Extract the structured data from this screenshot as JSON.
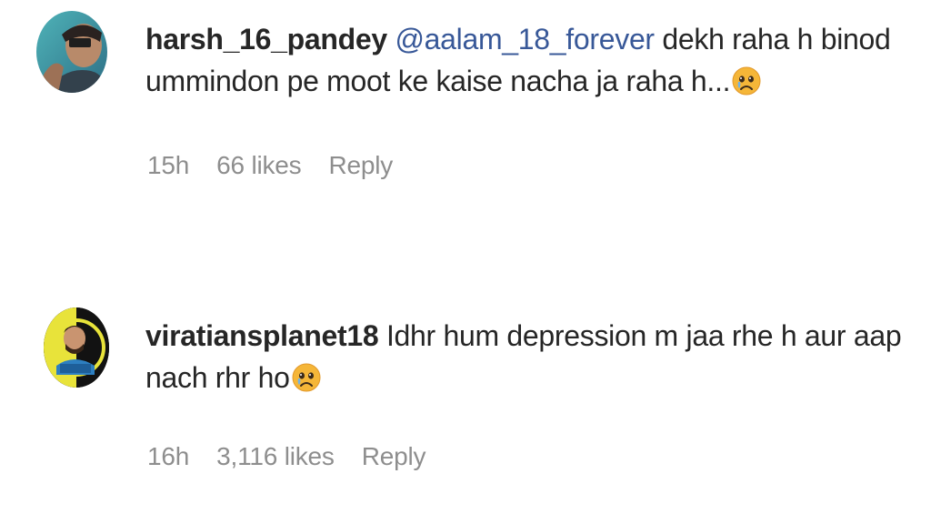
{
  "comments": [
    {
      "username": "harsh_16_pandey",
      "mention": "@aalam_18_forever",
      "text_line1": " dekh raha h binod",
      "text_line2": "ummindon pe moot ke kaise nacha ja raha h...",
      "emoji": "sad-emoji-icon",
      "time": "15h",
      "likes": "66 likes",
      "reply_label": "Reply"
    },
    {
      "username": "viratiansplanet18",
      "text_line1": " Idhr hum depression m jaa rhe h aur aap",
      "text_line2": "nach rhr ho",
      "emoji": "sad-emoji-icon",
      "time": "16h",
      "likes": "3,116 likes",
      "reply_label": "Reply"
    }
  ],
  "colors": {
    "text": "#262626",
    "mention": "#385898",
    "meta": "#8e8e8e"
  }
}
